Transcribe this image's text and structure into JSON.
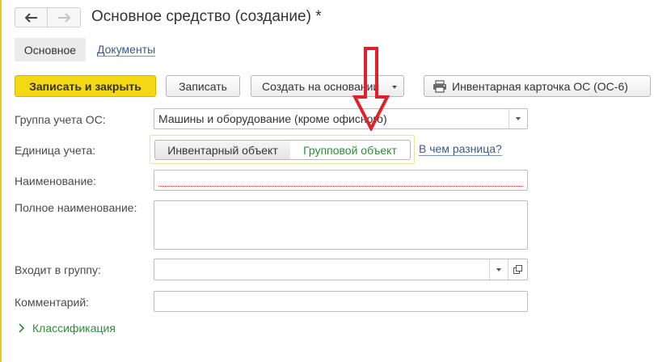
{
  "window": {
    "title": "Основное средство (создание) *"
  },
  "tabs": [
    {
      "label": "Основное",
      "active": true
    },
    {
      "label": "Документы",
      "active": false
    }
  ],
  "toolbar": {
    "save_close_label": "Записать и закрыть",
    "save_label": "Записать",
    "create_based_label": "Создать на основании",
    "inventory_card_label": "Инвентарная карточка ОС (ОС-6)"
  },
  "form": {
    "group_label": "Группа учета ОС:",
    "group_value": "Машины и оборудование (кроме офисного)",
    "unit_label": "Единица учета:",
    "unit_options": [
      "Инвентарный объект",
      "Групповой объект"
    ],
    "unit_selected": "Инвентарный объект",
    "unit_help_link": "В чем разница?",
    "name_label": "Наименование:",
    "name_value": "",
    "fullname_label": "Полное наименование:",
    "fullname_value": "",
    "parent_label": "Входит в группу:",
    "parent_value": "",
    "comment_label": "Комментарий:",
    "comment_value": "",
    "classification_label": "Классификация"
  },
  "colors": {
    "accent_yellow": "#f4d816",
    "link_blue": "#3a5a8c",
    "group_green": "#2e8b3a",
    "annotation_red": "#e0202a"
  },
  "icons": {
    "back": "arrow-left-icon",
    "forward": "arrow-right-icon",
    "print": "printer-icon",
    "dropdown": "chevron-down-icon",
    "open": "open-window-icon",
    "expand": "chevron-right-icon",
    "annotation": "red-down-arrow-icon"
  }
}
